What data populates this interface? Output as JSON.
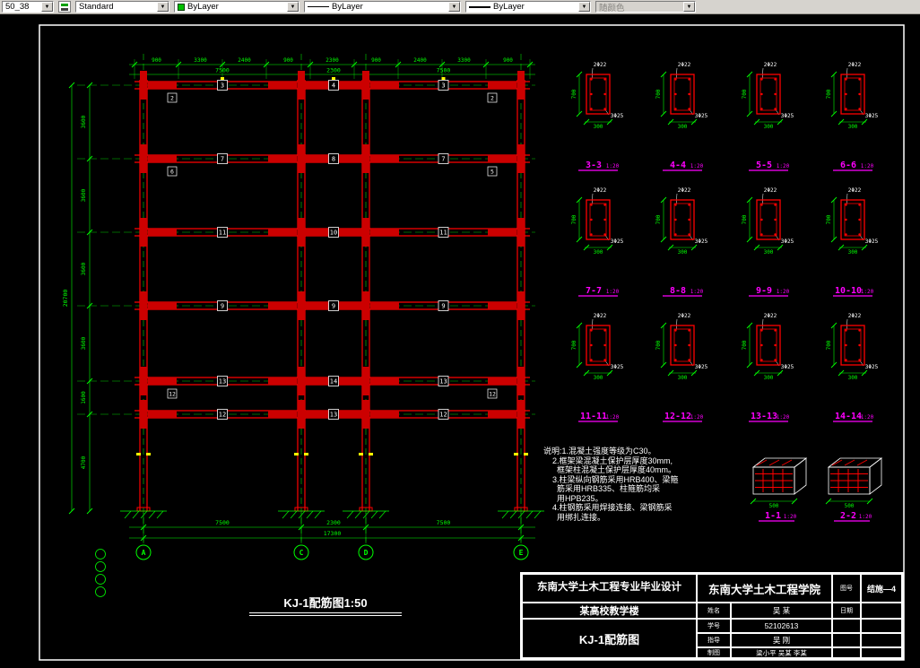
{
  "toolbar": {
    "dim_style": "50_38",
    "text_style": "Standard",
    "color_value": "ByLayer",
    "linetype_value": "ByLayer",
    "lineweight_value": "ByLayer",
    "plot_style": "随颜色"
  },
  "colors": {
    "canvas_bg": "#000000",
    "member_red": "#ff0000",
    "dimension_green": "#00ff00",
    "section_label_magenta": "#ff00ff",
    "mark_yellow": "#ffff00",
    "sheet_border_white": "#ffffff"
  },
  "frame": {
    "title": "KJ-1配筋图1:50",
    "axes": [
      "A",
      "C",
      "D",
      "E"
    ],
    "levels": [
      {
        "beams": [
          "3",
          "4",
          "3"
        ],
        "supports": [
          "2",
          "2"
        ]
      },
      {
        "beams": [
          "7",
          "8",
          "7"
        ],
        "supports": [
          "6",
          "5"
        ]
      },
      {
        "beams": [
          "11",
          "10",
          "11"
        ],
        "supports": [
          "",
          ""
        ]
      },
      {
        "beams": [
          "9",
          "9",
          "9"
        ],
        "supports": [
          "",
          ""
        ]
      },
      {
        "beams": [
          "13",
          "14",
          "13"
        ],
        "supports": [
          "12",
          "12"
        ]
      },
      {
        "beams": [
          "12",
          "13",
          "12"
        ],
        "supports": [
          "",
          ""
        ]
      }
    ]
  },
  "dims": {
    "top_segments": [
      "900",
      "3300",
      "2400",
      "900",
      "2300",
      "900",
      "2400",
      "3300",
      "900"
    ],
    "spans": [
      "7500",
      "2300",
      "7500"
    ],
    "total": "17300",
    "storeys": [
      "3600",
      "3600",
      "3600",
      "3600",
      "1600",
      "4700"
    ],
    "left_total": "20700"
  },
  "sections": {
    "scale": "1:20",
    "width_dim": "300",
    "height_dim": "700",
    "extra_dim": "500",
    "callout_top": "2Φ22",
    "callout_bottom": "3Φ25",
    "items": [
      {
        "label": "3-3"
      },
      {
        "label": "4-4"
      },
      {
        "label": "5-5"
      },
      {
        "label": "6-6"
      },
      {
        "label": "7-7"
      },
      {
        "label": "8-8"
      },
      {
        "label": "9-9"
      },
      {
        "label": "10-10"
      },
      {
        "label": "11-11"
      },
      {
        "label": "12-12"
      },
      {
        "label": "13-13"
      },
      {
        "label": "14-14"
      }
    ],
    "extras": [
      {
        "label": "1-1"
      },
      {
        "label": "2-2"
      }
    ]
  },
  "notes": {
    "lines": [
      "说明:1.混凝土强度等级为C30。",
      "    2.框架梁混凝土保护层厚度30mm,",
      "      框架柱混凝土保护层厚度40mm。",
      "    3.柱梁纵向钢筋采用HRB400、梁箍",
      "      筋采用HRB335、柱箍筋均采",
      "      用HPB235。",
      "    4.柱钢筋采用焊接连接、梁钢筋采",
      "      用绑扎连接。"
    ]
  },
  "title_block": {
    "project": "东南大学土木工程专业毕业设计",
    "building": "某高校教学楼",
    "drawing_name": "KJ-1配筋图",
    "school": "东南大学土木工程学院",
    "name_label": "姓名",
    "student_name": "吴 某",
    "id_label": "学号",
    "student_id": "52102613",
    "advisor_label": "指导",
    "advisor": "吴 刚",
    "draft_label": "制图",
    "team": "梁小平  吴某  李某",
    "no_label": "图号",
    "drawing_no": "结施—4",
    "date_label": "日期"
  }
}
